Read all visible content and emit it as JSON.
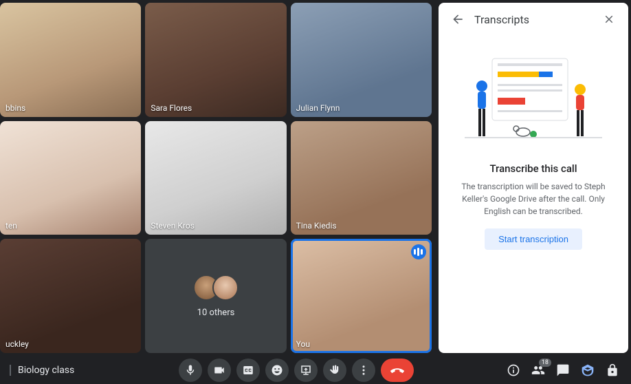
{
  "meeting": {
    "name": "Biology class"
  },
  "participants": [
    {
      "name": "bbins"
    },
    {
      "name": "Sara Flores"
    },
    {
      "name": "Julian Flynn"
    },
    {
      "name": "ten"
    },
    {
      "name": "Steven Kros"
    },
    {
      "name": "Tina Kiedis"
    },
    {
      "name": "uckley"
    },
    {
      "others_count": "10 others"
    },
    {
      "name": "You",
      "highlighted": true,
      "speaking": true
    }
  ],
  "panel": {
    "title": "Transcripts",
    "heading": "Transcribe this call",
    "description": "The transcription will be saved to Steph Keller's Google Drive after the call. Only English can be transcribed.",
    "start_button": "Start transcription"
  },
  "toolbar": {
    "participant_badge": "18"
  }
}
